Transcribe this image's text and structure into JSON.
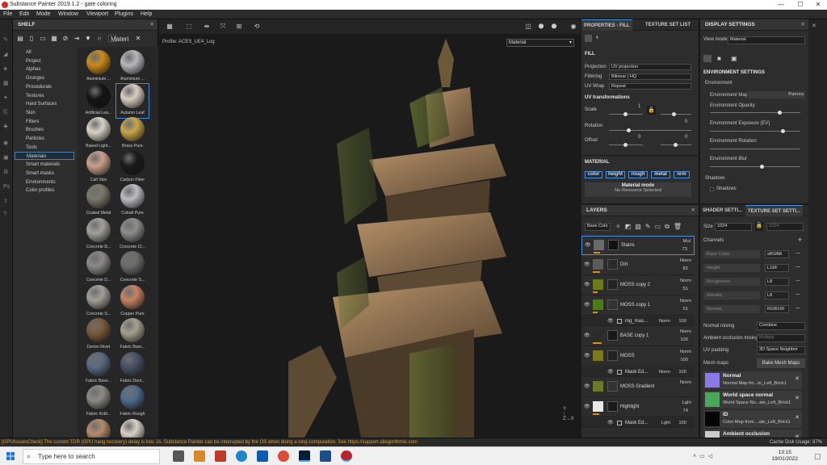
{
  "window": {
    "title": "Substance Painter 2019.1.2 - gate coloring",
    "minimize": "—",
    "maximize": "☐",
    "close": "✕"
  },
  "menu": [
    "File",
    "Edit",
    "Mode",
    "Window",
    "Viewport",
    "Plugins",
    "Help"
  ],
  "shelf": {
    "title": "SHELF",
    "search_value": "Materi",
    "categories": [
      "All",
      "Project",
      "Alphas",
      "Grunges",
      "Procedurals",
      "Textures",
      "Hard Surfaces",
      "Skin",
      "Filters",
      "Brushes",
      "Particles",
      "Tools",
      "Materials",
      "Smart materials",
      "Smart masks",
      "Environments",
      "Color profiles"
    ],
    "selected_category": "Materials",
    "materials": [
      {
        "name": "Aluminium ...",
        "color": "#c98a1c"
      },
      {
        "name": "Aluminium ...",
        "color": "#b8b8bc"
      },
      {
        "name": "Artificial Lea...",
        "color": "#141414"
      },
      {
        "name": "Autumn Leaf",
        "color": "#d8cfc0",
        "selected": true
      },
      {
        "name": "Baked Light...",
        "color": "#d9d3c6"
      },
      {
        "name": "Brass Pure",
        "color": "#c9a64a"
      },
      {
        "name": "Calf Skin",
        "color": "#caa08a"
      },
      {
        "name": "Carbon Fiber",
        "color": "#1a1a1c"
      },
      {
        "name": "Coated Metal",
        "color": "#7b7968"
      },
      {
        "name": "Cobalt Pure",
        "color": "#bcbcc2"
      },
      {
        "name": "Concrete B...",
        "color": "#a3a19b"
      },
      {
        "name": "Concrete Cl...",
        "color": "#8d8d8b"
      },
      {
        "name": "Concrete D...",
        "color": "#8a8986"
      },
      {
        "name": "Concrete S...",
        "color": "#6d6d6c"
      },
      {
        "name": "Concrete S...",
        "color": "#a29f97"
      },
      {
        "name": "Copper Pure",
        "color": "#c58462"
      },
      {
        "name": "Denim Rivet",
        "color": "#7a5a3a"
      },
      {
        "name": "Fabric Bam...",
        "color": "#a7a28e"
      },
      {
        "name": "Fabric Base...",
        "color": "#5a6a82"
      },
      {
        "name": "Fabric Deni...",
        "color": "#4a5264"
      },
      {
        "name": "Fabric Knitt...",
        "color": "#8d8a84"
      },
      {
        "name": "Fabric Rough",
        "color": "#4f6d8f"
      },
      {
        "name": "",
        "color": "#b58a6a"
      },
      {
        "name": "",
        "color": "#d8d2c6"
      }
    ]
  },
  "viewport": {
    "profile": "Profile: ACES_UE4_Log",
    "mode": "Material"
  },
  "properties": {
    "tab_active": "PROPERTIES - FILL",
    "tab_other": "TEXTURE SET LIST",
    "fill_title": "FILL",
    "projection_label": "Projection",
    "projection_value": "UV projection",
    "filtering_label": "Filtering",
    "filtering_value": "Bilinear | HQ",
    "uvwrap_label": "UV Wrap",
    "uvwrap_value": "Repeat",
    "uv_transform_title": "UV transformations",
    "scale_label": "Scale",
    "scale_value": "1",
    "rotation_label": "Rotation",
    "rotation_value": "0",
    "offset_label": "Offset",
    "offset_value_1": "0",
    "offset_value_2": "0",
    "material_title": "MATERIAL",
    "channels": [
      "color",
      "height",
      "rough",
      "metal",
      "nrm"
    ],
    "material_mode_label": "Material mode",
    "material_mode_value": "No Resource Selected"
  },
  "layers": {
    "title": "LAYERS",
    "channel_select": "Base Colo",
    "items": [
      {
        "name": "Stains",
        "blend": "Mul",
        "opacity": "73",
        "thumb": "#6a6a6a",
        "mask": "#111",
        "selected": true,
        "bar": 0.6
      },
      {
        "name": "Dirt",
        "blend": "Norm",
        "opacity": "82",
        "thumb": "#5b5b5b",
        "mask": "#2a2a2a",
        "bar": 0.7
      },
      {
        "name": "MOSS copy 2",
        "blend": "Norm",
        "opacity": "51",
        "thumb": "#6b7a1a",
        "mask": "#222",
        "bar": 0.45
      },
      {
        "name": "MOSS copy 1",
        "blend": "Norm",
        "opacity": "51",
        "thumb": "#4f7a1a",
        "mask": "#333",
        "bar": 0.45
      },
      {
        "sub": true,
        "name": "mg_mas...",
        "blend": "Norm",
        "opacity": "100"
      },
      {
        "name": "BASE copy 1",
        "blend": "Norm",
        "opacity": "100",
        "thumb": "#2b2b2b",
        "mask": "#181818",
        "bar": 0.85
      },
      {
        "name": "MOSS",
        "blend": "Norm",
        "opacity": "100",
        "thumb": "#7d7a1c",
        "mask": "#222",
        "bar": 0
      },
      {
        "sub": true,
        "name": "Mask Ed...",
        "blend": "Norm",
        "opacity": "100"
      },
      {
        "name": "MOSS Gradient",
        "blend": "Norm",
        "opacity": "",
        "thumb": "#6a7a2a",
        "mask": "#333",
        "bar": 0
      },
      {
        "name": "Highlight",
        "blend": "Lght",
        "opacity": "74",
        "thumb": "#e8e8e8",
        "mask": "#1a1a1a",
        "bar": 0.6
      },
      {
        "sub": true,
        "name": "Mask Ed...",
        "blend": "Lght",
        "opacity": "100"
      }
    ]
  },
  "display": {
    "title": "DISPLAY SETTINGS",
    "view_mode_label": "View mode",
    "view_mode_value": "Material",
    "env_title": "ENVIRONMENT SETTINGS",
    "environment_label": "Environment",
    "env_map_label": "Environment Map",
    "env_map_value": "Panora",
    "env_opacity_label": "Environment Opacity",
    "env_exposure_label": "Environment Exposure (EV)",
    "env_rotation_label": "Environment Rotation",
    "env_blur_label": "Environment Blur",
    "shadows_label": "Shadows",
    "shadows_checkbox_label": "Shadows"
  },
  "texture_set": {
    "tab_other": "SHADER SETTI...",
    "tab_active": "TEXTURE SET SETTI...",
    "size_label": "Size",
    "size_value": "1024",
    "size_value_2": "1024",
    "channels_label": "Channels",
    "channels": [
      {
        "name": "Base Color",
        "format": "sRGB8"
      },
      {
        "name": "Height",
        "format": "L16F"
      },
      {
        "name": "Roughness",
        "format": "L8"
      },
      {
        "name": "Metallic",
        "format": "L8"
      },
      {
        "name": "Normal",
        "format": "RGB16F"
      }
    ],
    "normal_mixing_label": "Normal mixing",
    "normal_mixing_value": "Combine",
    "ao_mixing_label": "Ambient occlusion mixing",
    "ao_mixing_value": "Multiply",
    "uv_padding_label": "UV padding",
    "uv_padding_value": "3D Space Neighbor",
    "mesh_maps_label": "Mesh maps",
    "bake_button": "Bake Mesh Maps",
    "maps": [
      {
        "title": "Normal",
        "sub": "Normal Map fro...te_Left_Brick1",
        "color": "#8a7ae8"
      },
      {
        "title": "World space normal",
        "sub": "World Space No...ate_Left_Brick1",
        "color": "#4aa85a"
      },
      {
        "title": "ID",
        "sub": "Color Map from ...ate_Left_Brick1",
        "color": "#050505"
      },
      {
        "title": "Ambient occlusion",
        "sub": "",
        "color": "#cccccc"
      }
    ]
  },
  "status": {
    "message": "[GPUIssuesCheck] The current TDR (GPU hang recovery) delay is low: 2s. Substance Painter can be interrupted by the OS when doing a long computation. See https://support.allegorithmic.com",
    "disk_label": "Cache Disk Usage:",
    "disk_value": "87%"
  },
  "taskbar": {
    "search_placeholder": "Type here to search",
    "time": "13:15",
    "date": "19/01/2022"
  }
}
